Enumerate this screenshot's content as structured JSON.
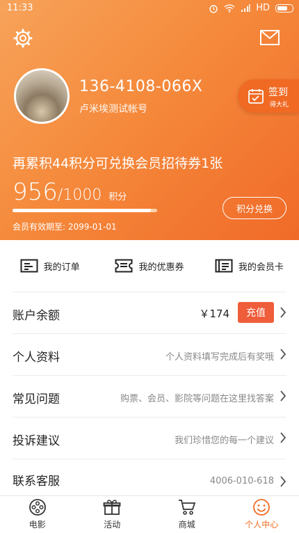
{
  "status": {
    "time": "11:33",
    "network": "HD"
  },
  "profile": {
    "phone": "136-4108-066X",
    "account_name": "卢米埃测试帐号"
  },
  "signin": {
    "label": "签到",
    "sub": "得大礼"
  },
  "points": {
    "promo": "再累积44积分可兑换会员招待券1张",
    "current": "956",
    "separator": "/",
    "total": "1000",
    "unit": "积分",
    "progress": 0.956,
    "redeem_label": "积分兑换",
    "expiry": "会员有效期至: 2099-01-01"
  },
  "quick_links": [
    {
      "label": "我的订单",
      "icon": "order-icon"
    },
    {
      "label": "我的优惠券",
      "icon": "coupon-icon"
    },
    {
      "label": "我的会员卡",
      "icon": "membership-card-icon"
    }
  ],
  "rows": [
    {
      "title": "账户余额",
      "value": "￥174",
      "action": "充值"
    },
    {
      "title": "个人资料",
      "desc": "个人资料填写完成后有奖哦"
    },
    {
      "title": "常见问题",
      "desc": "购票、会员、影院等问题在这里找答案"
    },
    {
      "title": "投诉建议",
      "desc": "我们珍惜您的每一个建议"
    },
    {
      "title": "联系客服",
      "desc": "4006-010-618"
    }
  ],
  "tabs": [
    {
      "label": "电影",
      "icon": "film-reel-icon"
    },
    {
      "label": "活动",
      "icon": "gift-icon"
    },
    {
      "label": "商城",
      "icon": "shopping-cart-icon"
    },
    {
      "label": "个人中心",
      "icon": "smiley-icon",
      "active": true
    }
  ],
  "colors": {
    "accent": "#f26b21",
    "recharge": "#ef5d3a",
    "header_start": "#f7a35a",
    "header_end": "#f06a28"
  }
}
